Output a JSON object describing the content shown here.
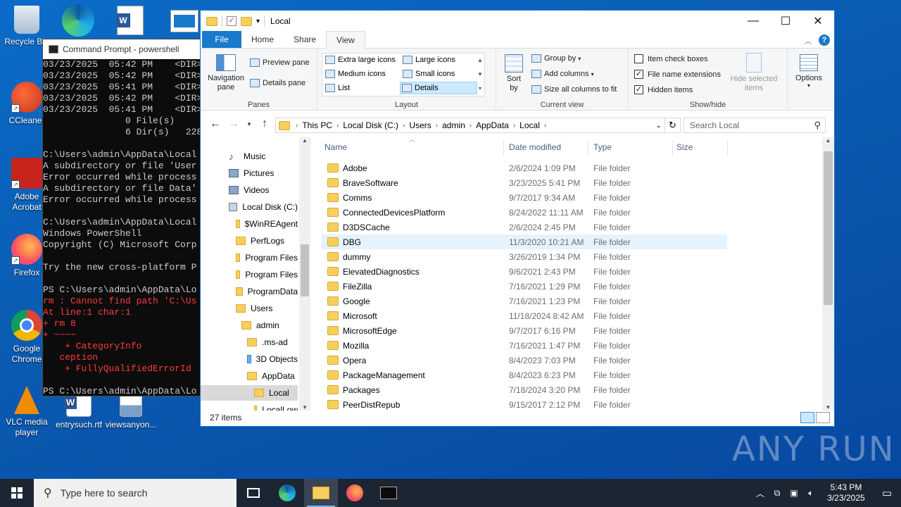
{
  "desktop": {
    "icons": [
      {
        "label": "Recycle Bin"
      },
      {
        "label": "CCleaner"
      },
      {
        "label": "Adobe Acrobat"
      },
      {
        "label": "Firefox"
      },
      {
        "label": "Google Chrome"
      },
      {
        "label": "VLC media player"
      },
      {
        "label": "entrysuch.rtf"
      },
      {
        "label": "viewsanyon..."
      }
    ]
  },
  "cmd": {
    "title": "Command Prompt - powershell",
    "lines": [
      {
        "text": "03/23/2025  05:42 PM    <DIR>",
        "color": "#cccccc"
      },
      {
        "text": "03/23/2025  05:42 PM    <DIR>",
        "color": "#cccccc"
      },
      {
        "text": "03/23/2025  05:41 PM    <DIR>",
        "color": "#cccccc"
      },
      {
        "text": "03/23/2025  05:42 PM    <DIR>",
        "color": "#cccccc"
      },
      {
        "text": "03/23/2025  05:41 PM    <DIR>",
        "color": "#cccccc"
      },
      {
        "text": "               0 File(s)",
        "color": "#cccccc"
      },
      {
        "text": "               6 Dir(s)   228",
        "color": "#cccccc"
      },
      {
        "text": "",
        "color": "#cccccc"
      },
      {
        "text": "C:\\Users\\admin\\AppData\\Local",
        "color": "#cccccc"
      },
      {
        "text": "A subdirectory or file 'User",
        "color": "#cccccc"
      },
      {
        "text": "Error occurred while process",
        "color": "#cccccc"
      },
      {
        "text": "A subdirectory or file Data'",
        "color": "#cccccc"
      },
      {
        "text": "Error occurred while process",
        "color": "#cccccc"
      },
      {
        "text": "",
        "color": "#cccccc"
      },
      {
        "text": "C:\\Users\\admin\\AppData\\Local",
        "color": "#cccccc"
      },
      {
        "text": "Windows PowerShell",
        "color": "#cccccc"
      },
      {
        "text": "Copyright (C) Microsoft Corp",
        "color": "#cccccc"
      },
      {
        "text": "",
        "color": "#cccccc"
      },
      {
        "text": "Try the new cross-platform P",
        "color": "#cccccc"
      },
      {
        "text": "",
        "color": "#cccccc"
      },
      {
        "text": "PS C:\\Users\\admin\\AppData\\Lo",
        "color": "#cccccc"
      },
      {
        "text": "rm : Cannot find path 'C:\\Us",
        "color": "#ff3b3b"
      },
      {
        "text": "At line:1 char:1",
        "color": "#ff3b3b"
      },
      {
        "text": "+ rm 8",
        "color": "#ff3b3b"
      },
      {
        "text": "+ ~~~~",
        "color": "#ff3b3b"
      },
      {
        "text": "    + CategoryInfo",
        "color": "#ff3b3b"
      },
      {
        "text": "   ception",
        "color": "#ff3b3b"
      },
      {
        "text": "    + FullyQualifiedErrorId",
        "color": "#ff3b3b"
      },
      {
        "text": "",
        "color": "#cccccc"
      },
      {
        "text": "PS C:\\Users\\admin\\AppData\\Lo",
        "color": "#cccccc"
      }
    ]
  },
  "explorer": {
    "title": "Local",
    "window_buttons": {
      "minimize": "—",
      "maximize": "☐",
      "close": "✕"
    },
    "tabs": [
      "File",
      "Home",
      "Share",
      "View"
    ],
    "active_tab": "View",
    "ribbon": {
      "panes": {
        "label": "Panes",
        "navigation_pane": "Navigation pane",
        "preview_pane": "Preview pane",
        "details_pane": "Details pane"
      },
      "layout": {
        "label": "Layout",
        "items": [
          "Extra large icons",
          "Large icons",
          "Medium icons",
          "Small icons",
          "List",
          "Details"
        ],
        "selected": "Details"
      },
      "current_view": {
        "label": "Current view",
        "sort_by": "Sort by",
        "group_by": "Group by",
        "add_columns": "Add columns",
        "size_all_columns": "Size all columns to fit"
      },
      "show_hide": {
        "label": "Show/hide",
        "item_check_boxes": {
          "label": "Item check boxes",
          "checked": false
        },
        "file_name_extensions": {
          "label": "File name extensions",
          "checked": true
        },
        "hidden_items": {
          "label": "Hidden items",
          "checked": true
        },
        "hide_selected_items": "Hide selected items"
      },
      "options": "Options"
    },
    "address": {
      "crumbs": [
        "This PC",
        "Local Disk (C:)",
        "Users",
        "admin",
        "AppData",
        "Local"
      ]
    },
    "search_placeholder": "Search Local",
    "nav_pane": [
      {
        "label": "Music",
        "icon": "music-icon"
      },
      {
        "label": "Pictures",
        "icon": "pictures-icon"
      },
      {
        "label": "Videos",
        "icon": "videos-icon"
      },
      {
        "label": "Local Disk (C:)",
        "icon": "drive-icon"
      },
      {
        "label": "$WinREAgent",
        "icon": "folder-icon"
      },
      {
        "label": "PerfLogs",
        "icon": "folder-icon"
      },
      {
        "label": "Program Files",
        "icon": "folder-icon"
      },
      {
        "label": "Program Files",
        "icon": "folder-icon"
      },
      {
        "label": "ProgramData",
        "icon": "folder-icon"
      },
      {
        "label": "Users",
        "icon": "folder-icon"
      },
      {
        "label": "admin",
        "icon": "folder-icon"
      },
      {
        "label": ".ms-ad",
        "icon": "folder-icon"
      },
      {
        "label": "3D Objects",
        "icon": "3d-objects-icon"
      },
      {
        "label": "AppData",
        "icon": "folder-icon"
      },
      {
        "label": "Local",
        "icon": "folder-icon"
      },
      {
        "label": "LocalLow",
        "icon": "folder-icon"
      }
    ],
    "nav_selected": "Local",
    "columns": [
      "Name",
      "Date modified",
      "Type",
      "Size"
    ],
    "files": [
      {
        "name": "Adobe",
        "date": "2/6/2024 1:09 PM",
        "type": "File folder"
      },
      {
        "name": "BraveSoftware",
        "date": "3/23/2025 5:41 PM",
        "type": "File folder"
      },
      {
        "name": "Comms",
        "date": "9/7/2017 9:34 AM",
        "type": "File folder"
      },
      {
        "name": "ConnectedDevicesPlatform",
        "date": "8/24/2022 11:11 AM",
        "type": "File folder"
      },
      {
        "name": "D3DSCache",
        "date": "2/6/2024 2:45 PM",
        "type": "File folder"
      },
      {
        "name": "DBG",
        "date": "11/3/2020 10:21 AM",
        "type": "File folder"
      },
      {
        "name": "dummy",
        "date": "3/26/2019 1:34 PM",
        "type": "File folder"
      },
      {
        "name": "ElevatedDiagnostics",
        "date": "9/6/2021 2:43 PM",
        "type": "File folder"
      },
      {
        "name": "FileZilla",
        "date": "7/16/2021 1:29 PM",
        "type": "File folder"
      },
      {
        "name": "Google",
        "date": "7/16/2021 1:23 PM",
        "type": "File folder"
      },
      {
        "name": "Microsoft",
        "date": "11/18/2024 8:42 AM",
        "type": "File folder"
      },
      {
        "name": "MicrosoftEdge",
        "date": "9/7/2017 6:16 PM",
        "type": "File folder"
      },
      {
        "name": "Mozilla",
        "date": "7/16/2021 1:47 PM",
        "type": "File folder"
      },
      {
        "name": "Opera",
        "date": "8/4/2023 7:03 PM",
        "type": "File folder"
      },
      {
        "name": "PackageManagement",
        "date": "8/4/2023 6:23 PM",
        "type": "File folder"
      },
      {
        "name": "Packages",
        "date": "7/18/2024 3:20 PM",
        "type": "File folder"
      },
      {
        "name": "PeerDistRepub",
        "date": "9/15/2017 2:12 PM",
        "type": "File folder"
      }
    ],
    "hovered_file": "DBG",
    "status": "27 items"
  },
  "watermark": "ANY RUN",
  "taskbar": {
    "search_placeholder": "Type here to search",
    "pinned": [
      "task-view",
      "edge",
      "file-explorer",
      "firefox",
      "cmd"
    ],
    "active": "file-explorer",
    "time": "5:43 PM",
    "date": "3/23/2025"
  },
  "colors": {
    "desktop_blue": "#0b5cb3",
    "accent": "#1979ca",
    "folder_yellow": "#f7cf5a",
    "cmd_error": "#ff3b3b",
    "taskbar": "#1c2532"
  }
}
